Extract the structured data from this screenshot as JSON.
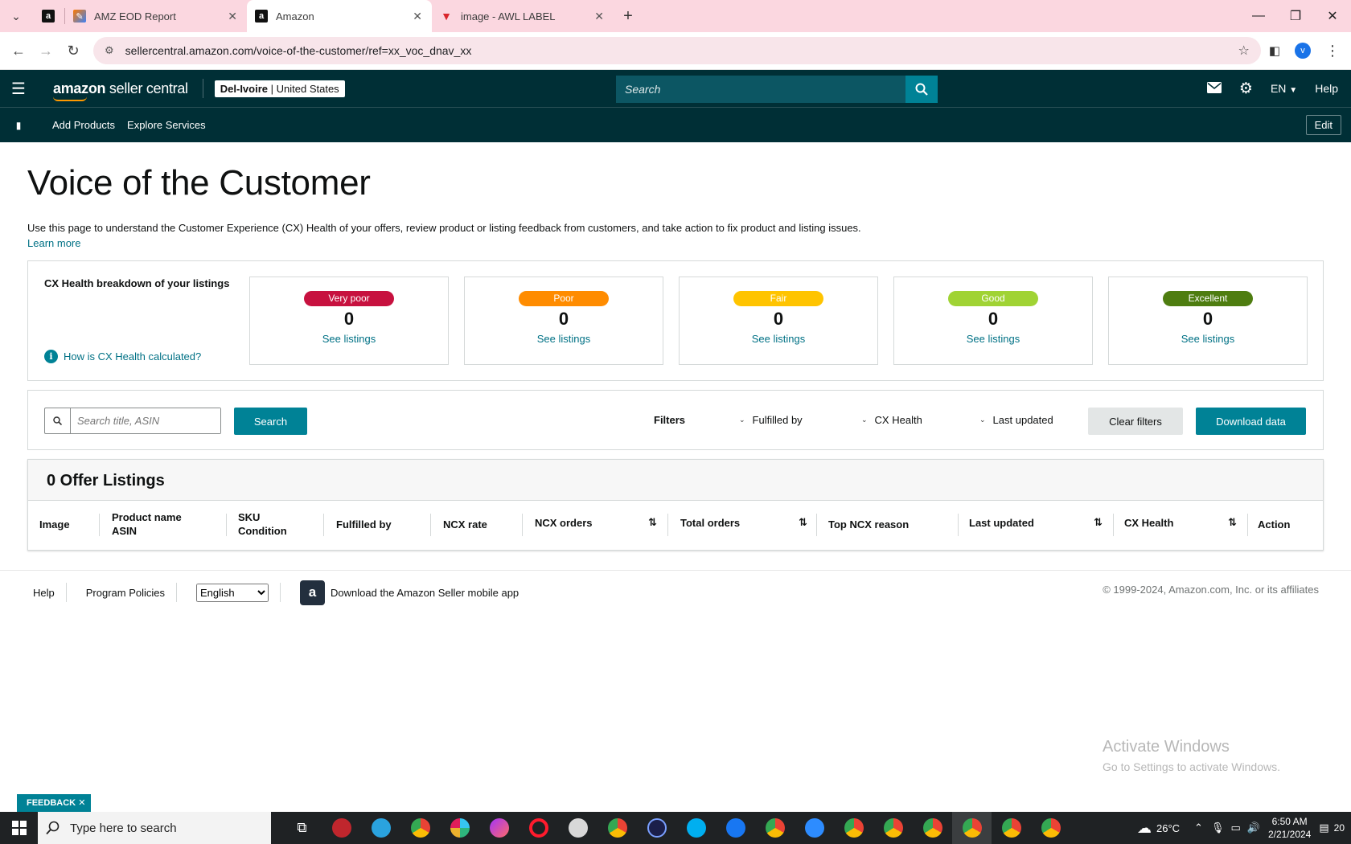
{
  "browser": {
    "tabs": [
      {
        "title": "",
        "icon": "amazon-a-icon",
        "pinned": true
      },
      {
        "title": "AMZ EOD Report",
        "icon": "report-icon"
      },
      {
        "title": "Amazon",
        "icon": "amazon-a-icon",
        "active": true
      },
      {
        "title": "image - AWL LABEL",
        "icon": "awl-icon"
      }
    ],
    "url": "sellercentral.amazon.com/voice-of-the-customer/ref=xx_voc_dnav_xx",
    "profile_initial": "v"
  },
  "header": {
    "logo_bold": "amazon",
    "logo_rest": " seller central",
    "store_name": "Del-Ivoire",
    "marketplace": "United States",
    "search_placeholder": "Search",
    "language": "EN",
    "help": "Help"
  },
  "subnav": {
    "items": [
      "Add Products",
      "Explore Services"
    ],
    "edit": "Edit"
  },
  "page": {
    "title": "Voice of the Customer",
    "intro": "Use this page to understand the Customer Experience (CX) Health of your offers, review product or listing feedback from customers, and take action to fix product and listing issues.",
    "learn_more": "Learn more"
  },
  "cx_health": {
    "title": "CX Health breakdown of your listings",
    "how_link": "How is CX Health calculated?",
    "cards": [
      {
        "label": "Very poor",
        "count": "0",
        "link": "See listings",
        "color": "#c7113f"
      },
      {
        "label": "Poor",
        "count": "0",
        "link": "See listings",
        "color": "#ff8c00"
      },
      {
        "label": "Fair",
        "count": "0",
        "link": "See listings",
        "color": "#ffc400"
      },
      {
        "label": "Good",
        "count": "0",
        "link": "See listings",
        "color": "#a0d334"
      },
      {
        "label": "Excellent",
        "count": "0",
        "link": "See listings",
        "color": "#4e7d10"
      }
    ]
  },
  "filters": {
    "search_placeholder": "Search title, ASIN",
    "search_button": "Search",
    "label": "Filters",
    "dropdowns": [
      "Fulfilled by",
      "CX Health",
      "Last updated"
    ],
    "clear": "Clear filters",
    "download": "Download data"
  },
  "listings": {
    "heading": "0 Offer Listings",
    "columns": {
      "image": "Image",
      "product_name": "Product name",
      "asin": "ASIN",
      "sku": "SKU",
      "condition": "Condition",
      "fulfilled_by": "Fulfilled by",
      "ncx_rate": "NCX rate",
      "ncx_orders": "NCX orders",
      "total_orders": "Total orders",
      "top_ncx_reason": "Top NCX reason",
      "last_updated": "Last updated",
      "cx_health": "CX Health",
      "action": "Action"
    }
  },
  "footer": {
    "help": "Help",
    "policies": "Program Policies",
    "language": "English",
    "app": "Download the Amazon Seller mobile app",
    "copyright": "© 1999-2024, Amazon.com, Inc. or its affiliates"
  },
  "watermark": {
    "line1": "Activate Windows",
    "line2": "Go to Settings to activate Windows."
  },
  "feedback": "FEEDBACK",
  "taskbar": {
    "search_placeholder": "Type here to search",
    "weather": "26°C",
    "time": "6:50 AM",
    "date": "2/21/2024",
    "notifications": "20"
  }
}
